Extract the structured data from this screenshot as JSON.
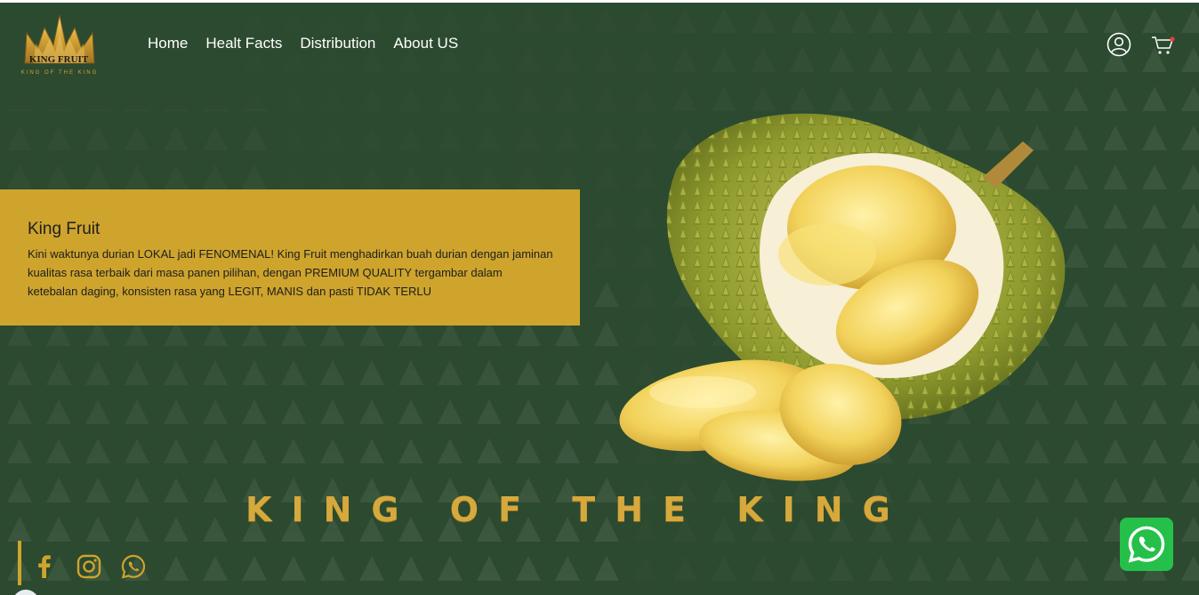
{
  "brand": {
    "name": "KING FRUIT",
    "tagline_small": "KING OF THE KING"
  },
  "nav": {
    "items": [
      {
        "label": "Home"
      },
      {
        "label": "Healt Facts"
      },
      {
        "label": "Distribution"
      },
      {
        "label": "About US"
      }
    ]
  },
  "header_icons": [
    "user-icon",
    "cart-icon"
  ],
  "hero": {
    "title": "King Fruit",
    "description": "Kini waktunya durian LOKAL jadi FENOMENAL! King Fruit menghadirkan buah durian dengan jaminan kualitas rasa terbaik dari masa panen pilihan, dengan PREMIUM QUALITY tergambar dalam ketebalan daging, konsisten rasa yang LEGIT, MANIS dan pasti TIDAK TERLU",
    "tagline": "KING OF THE KING"
  },
  "social": [
    "facebook-icon",
    "instagram-icon",
    "whatsapp-icon"
  ],
  "floating_button": "whatsapp-icon",
  "colors": {
    "background": "#2c4a2f",
    "accent_gold": "#cea42d",
    "whatsapp_green": "#25c04a",
    "nav_text": "#ffffff"
  }
}
